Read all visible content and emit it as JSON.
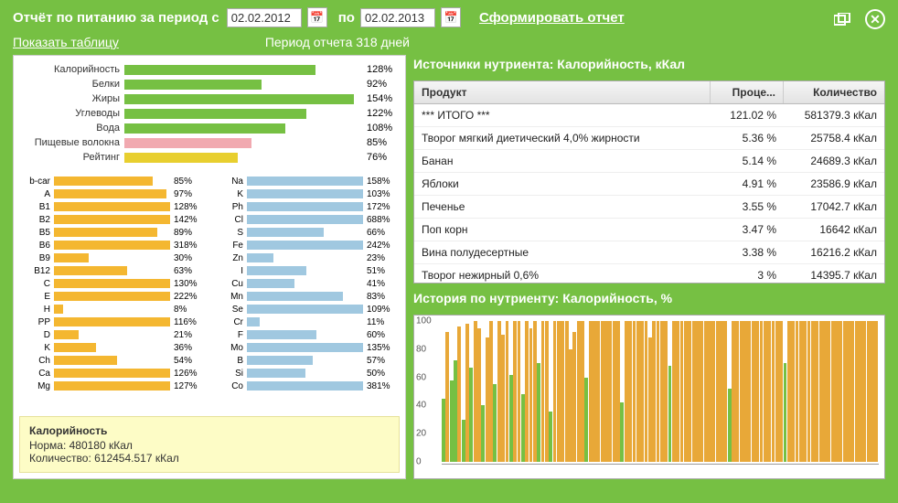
{
  "header": {
    "title_prefix": "Отчёт по питанию за период с",
    "date_from": "02.02.2012",
    "po_label": "по",
    "date_to": "02.02.2013",
    "gen_label": "Сформировать отчет"
  },
  "sub": {
    "show_table": "Показать таблицу",
    "period_note": "Период отчета 318 дней"
  },
  "chart_data": {
    "summary_bars": {
      "type": "bar",
      "orientation": "horizontal",
      "max_scale": 160,
      "items": [
        {
          "label": "Калорийность",
          "pct": 128,
          "color": "green"
        },
        {
          "label": "Белки",
          "pct": 92,
          "color": "green"
        },
        {
          "label": "Жиры",
          "pct": 154,
          "color": "green"
        },
        {
          "label": "Углеводы",
          "pct": 122,
          "color": "green"
        },
        {
          "label": "Вода",
          "pct": 108,
          "color": "green"
        },
        {
          "label": "Пищевые волокна",
          "pct": 85,
          "color": "pink"
        },
        {
          "label": "Рейтинг",
          "pct": 76,
          "color": "yellow"
        }
      ]
    },
    "nutrients_left": {
      "type": "bar",
      "orientation": "horizontal",
      "max_scale": 100,
      "color": "orange",
      "items": [
        {
          "label": "b-car",
          "pct": 85
        },
        {
          "label": "A",
          "pct": 97
        },
        {
          "label": "B1",
          "pct": 128
        },
        {
          "label": "B2",
          "pct": 142
        },
        {
          "label": "B5",
          "pct": 89
        },
        {
          "label": "B6",
          "pct": 318
        },
        {
          "label": "B9",
          "pct": 30
        },
        {
          "label": "B12",
          "pct": 63
        },
        {
          "label": "C",
          "pct": 130
        },
        {
          "label": "E",
          "pct": 222
        },
        {
          "label": "H",
          "pct": 8
        },
        {
          "label": "PP",
          "pct": 116
        },
        {
          "label": "D",
          "pct": 21
        },
        {
          "label": "K",
          "pct": 36
        },
        {
          "label": "Ch",
          "pct": 54
        },
        {
          "label": "Ca",
          "pct": 126
        },
        {
          "label": "Mg",
          "pct": 127
        }
      ]
    },
    "nutrients_right": {
      "type": "bar",
      "orientation": "horizontal",
      "max_scale": 100,
      "color": "blue",
      "items": [
        {
          "label": "Na",
          "pct": 158
        },
        {
          "label": "K",
          "pct": 103
        },
        {
          "label": "Ph",
          "pct": 172
        },
        {
          "label": "Cl",
          "pct": 688
        },
        {
          "label": "S",
          "pct": 66
        },
        {
          "label": "Fe",
          "pct": 242
        },
        {
          "label": "Zn",
          "pct": 23
        },
        {
          "label": "I",
          "pct": 51
        },
        {
          "label": "Cu",
          "pct": 41
        },
        {
          "label": "Mn",
          "pct": 83
        },
        {
          "label": "Se",
          "pct": 109
        },
        {
          "label": "Cr",
          "pct": 11
        },
        {
          "label": "F",
          "pct": 60
        },
        {
          "label": "Mo",
          "pct": 135
        },
        {
          "label": "B",
          "pct": 57
        },
        {
          "label": "Si",
          "pct": 50
        },
        {
          "label": "Co",
          "pct": 381
        }
      ]
    },
    "history": {
      "type": "bar",
      "title": "История по нутриенту: Калорийность, %",
      "yticks": [
        0,
        20,
        40,
        60,
        80,
        100
      ],
      "ylim": [
        0,
        100
      ],
      "values": [
        45,
        92,
        58,
        72,
        96,
        30,
        98,
        67,
        100,
        95,
        40,
        88,
        100,
        55,
        100,
        90,
        100,
        62,
        100,
        100,
        48,
        100,
        95,
        100,
        70,
        100,
        100,
        36,
        100,
        100,
        100,
        100,
        80,
        92,
        100,
        100,
        60,
        100,
        100,
        100,
        100,
        100,
        100,
        100,
        100,
        42,
        100,
        100,
        100,
        100,
        100,
        100,
        88,
        100,
        100,
        100,
        100,
        68,
        100,
        100,
        100,
        100,
        100,
        100,
        100,
        100,
        100,
        100,
        100,
        100,
        100,
        100,
        52,
        100,
        100,
        100,
        100,
        100,
        100,
        100,
        100,
        100,
        100,
        100,
        100,
        100,
        70,
        100,
        100,
        100,
        100,
        100,
        100,
        100,
        100,
        100,
        100,
        100,
        100,
        100,
        100,
        100,
        100,
        100,
        100,
        100,
        100,
        100,
        100,
        100
      ]
    }
  },
  "summary_box": {
    "title": "Калорийность",
    "norm_line": "Норма: 480180 кКал",
    "qty_line": "Количество: 612454.517 кКал"
  },
  "sources": {
    "title": "Источники нутриента: Калорийность, кКал",
    "col_product": "Продукт",
    "col_pct": "Проце...",
    "col_qty": "Количество",
    "rows": [
      {
        "product": "*** ИТОГО ***",
        "pct": "121.02 %",
        "qty": "581379.3 кКал"
      },
      {
        "product": "Творог мягкий диетический 4,0% жирности",
        "pct": "5.36 %",
        "qty": "25758.4 кКал"
      },
      {
        "product": "Банан",
        "pct": "5.14 %",
        "qty": "24689.3 кКал"
      },
      {
        "product": "Яблоки",
        "pct": "4.91 %",
        "qty": "23586.9 кКал"
      },
      {
        "product": "Печенье",
        "pct": "3.55 %",
        "qty": "17042.7 кКал"
      },
      {
        "product": "Поп корн",
        "pct": "3.47 %",
        "qty": "16642 кКал"
      },
      {
        "product": "Вина полудесертные",
        "pct": "3.38 %",
        "qty": "16216.2 кКал"
      },
      {
        "product": "Творог нежирный 0,6%",
        "pct": "3 %",
        "qty": "14395.7 кКал"
      }
    ]
  },
  "history_title": "История по нутриенту: Калорийность, %"
}
